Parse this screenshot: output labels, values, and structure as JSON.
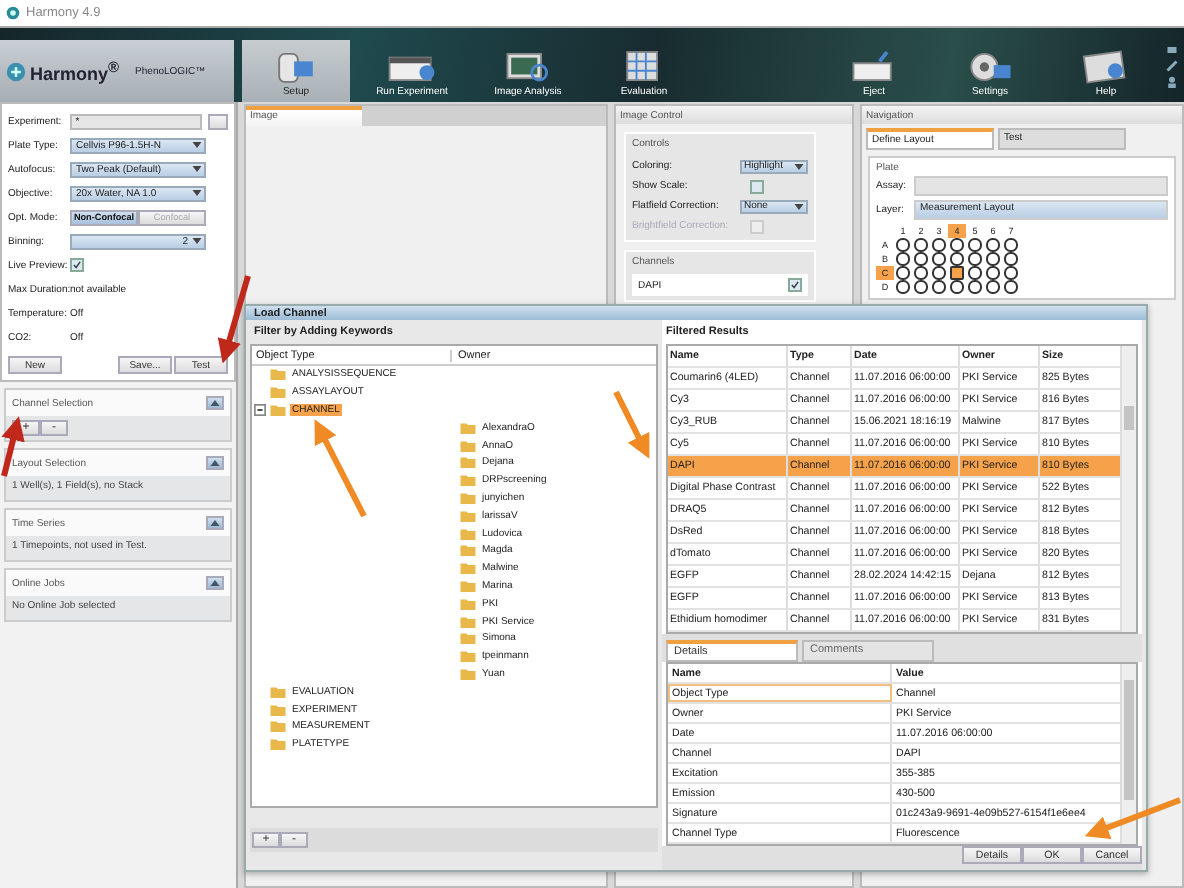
{
  "window": {
    "title": "Harmony 4.9"
  },
  "logo": {
    "name": "Harmony$^{®}$",
    "product": "PhenoLOGIC™"
  },
  "nav": [
    {
      "label": "Setup",
      "kind": "setup",
      "selected": true
    },
    {
      "label": "Run Experiment",
      "kind": "run",
      "selected": false
    },
    {
      "label": "Image Analysis",
      "kind": "analysis",
      "selected": false
    },
    {
      "label": "Evaluation",
      "kind": "evaluation",
      "selected": false
    },
    {
      "label": "Eject",
      "kind": "eject",
      "selected": false
    },
    {
      "label": "Settings",
      "kind": "settings",
      "selected": false
    },
    {
      "label": "Help",
      "kind": "help",
      "selected": false
    }
  ],
  "setup": {
    "fields": [
      {
        "label": "Experiment:",
        "kind": "input",
        "value": "*"
      },
      {
        "label": "Plate Type:",
        "kind": "dropdown",
        "value": "Cellvis P96-1.5H-N"
      },
      {
        "label": "Autofocus:",
        "kind": "dropdown",
        "value": "Two Peak (Default)"
      },
      {
        "label": "Objective:",
        "kind": "dropdown",
        "value": "20x Water, NA 1.0"
      },
      {
        "label": "Opt. Mode:",
        "kind": "segmented",
        "options": [
          {
            "label": "Non-Confocal",
            "selected": true
          },
          {
            "label": "Confocal",
            "selected": false
          }
        ]
      },
      {
        "label": "Binning:",
        "kind": "dropdown",
        "value": "2"
      },
      {
        "label": "Live Preview:",
        "kind": "checkbox",
        "checked": true
      },
      {
        "label": "Max Duration:",
        "kind": "text",
        "value": "not available"
      },
      {
        "label": "Temperature:",
        "kind": "text",
        "value": "Off"
      },
      {
        "label": "CO2:",
        "kind": "text",
        "value": "Off"
      }
    ],
    "buttons": [
      "New",
      "Save...",
      "Test"
    ]
  },
  "panels": [
    {
      "title": "Channel Selection",
      "buttons": [
        "+",
        "-"
      ]
    },
    {
      "title": "Layout Selection",
      "summary": "1 Well(s), 1 Field(s), no Stack"
    },
    {
      "title": "Time Series",
      "summary": "1 Timepoints, not used in Test."
    },
    {
      "title": "Online Jobs",
      "summary": "No Online Job selected"
    }
  ],
  "image_panel": {
    "tab": "Image"
  },
  "image_control": {
    "title": "Image Control",
    "controls_title": "Controls",
    "rows": [
      {
        "label": "Coloring:",
        "kind": "dropdown",
        "value": "Highlight",
        "disabled": false
      },
      {
        "label": "Show Scale:",
        "kind": "checkbox",
        "checked": false,
        "disabled": false
      },
      {
        "label": "Flatfield Correction:",
        "kind": "dropdown",
        "value": "None",
        "disabled": false
      },
      {
        "label": "Brightfield Correction:",
        "kind": "checkbox",
        "checked": false,
        "disabled": true
      }
    ],
    "channels_title": "Channels",
    "channels": [
      {
        "name": "DAPI",
        "checked": true
      }
    ]
  },
  "navigation": {
    "title": "Navigation",
    "tabs": [
      {
        "label": "Define Layout",
        "selected": true
      },
      {
        "label": "Test",
        "selected": false
      }
    ],
    "plate_title": "Plate",
    "assay_label": "Assay:",
    "layer_label": "Layer:",
    "layer_value": "Measurement Layout",
    "columns": [
      {
        "label": "1",
        "selected": false
      },
      {
        "label": "2",
        "selected": false
      },
      {
        "label": "3",
        "selected": false
      },
      {
        "label": "4",
        "selected": true
      },
      {
        "label": "5",
        "selected": false
      },
      {
        "label": "6",
        "selected": false
      },
      {
        "label": "7",
        "selected": false
      }
    ],
    "rows": [
      {
        "label": "A",
        "selected": false
      },
      {
        "label": "B",
        "selected": false
      },
      {
        "label": "C",
        "selected": true
      },
      {
        "label": "D",
        "selected": false
      }
    ]
  },
  "dialog": {
    "title": "Load Channel",
    "filter_title": "Filter by Adding Keywords",
    "tree_columns": [
      "Object Type",
      "Owner"
    ],
    "tree": [
      {
        "label": "ANALYSISSEQUENCE",
        "selected": false
      },
      {
        "label": "ASSAYLAYOUT",
        "selected": false
      },
      {
        "label": "CHANNEL",
        "selected": true,
        "children": [
          {
            "label": "AlexandraO"
          },
          {
            "label": "AnnaO"
          },
          {
            "label": "Dejana"
          },
          {
            "label": "DRPscreening"
          },
          {
            "label": "junyichen"
          },
          {
            "label": "larissaV"
          },
          {
            "label": "Ludovica"
          },
          {
            "label": "Magda"
          },
          {
            "label": "Malwine"
          },
          {
            "label": "Marina"
          },
          {
            "label": "PKI"
          },
          {
            "label": "PKI Service"
          },
          {
            "label": "Simona"
          },
          {
            "label": "tpeinmann"
          },
          {
            "label": "Yuan"
          }
        ]
      },
      {
        "label": "EVALUATION",
        "selected": false
      },
      {
        "label": "EXPERIMENT",
        "selected": false
      },
      {
        "label": "MEASUREMENT",
        "selected": false
      },
      {
        "label": "PLATETYPE",
        "selected": false
      }
    ],
    "tree_buttons": [
      "+",
      "-"
    ],
    "results_title": "Filtered Results",
    "result_columns": [
      "Name",
      "Type",
      "Date",
      "Owner",
      "Size"
    ],
    "results": [
      {
        "cells": [
          "Coumarin6 (4LED)",
          "Channel",
          "11.07.2016 06:00:00",
          "PKI Service",
          "825 Bytes"
        ],
        "selected": false
      },
      {
        "cells": [
          "Cy3",
          "Channel",
          "11.07.2016 06:00:00",
          "PKI Service",
          "816 Bytes"
        ],
        "selected": false
      },
      {
        "cells": [
          "Cy3_RUB",
          "Channel",
          "15.06.2021 18:16:19",
          "Malwine",
          "817 Bytes"
        ],
        "selected": false
      },
      {
        "cells": [
          "Cy5",
          "Channel",
          "11.07.2016 06:00:00",
          "PKI Service",
          "810 Bytes"
        ],
        "selected": false
      },
      {
        "cells": [
          "DAPI",
          "Channel",
          "11.07.2016 06:00:00",
          "PKI Service",
          "810 Bytes"
        ],
        "selected": true
      },
      {
        "cells": [
          "Digital Phase Contrast",
          "Channel",
          "11.07.2016 06:00:00",
          "PKI Service",
          "522 Bytes"
        ],
        "selected": false
      },
      {
        "cells": [
          "DRAQ5",
          "Channel",
          "11.07.2016 06:00:00",
          "PKI Service",
          "812 Bytes"
        ],
        "selected": false
      },
      {
        "cells": [
          "DsRed",
          "Channel",
          "11.07.2016 06:00:00",
          "PKI Service",
          "818 Bytes"
        ],
        "selected": false
      },
      {
        "cells": [
          "dTomato",
          "Channel",
          "11.07.2016 06:00:00",
          "PKI Service",
          "820 Bytes"
        ],
        "selected": false
      },
      {
        "cells": [
          "EGFP",
          "Channel",
          "28.02.2024 14:42:15",
          "Dejana",
          "812 Bytes"
        ],
        "selected": false
      },
      {
        "cells": [
          "EGFP",
          "Channel",
          "11.07.2016 06:00:00",
          "PKI Service",
          "813 Bytes"
        ],
        "selected": false
      },
      {
        "cells": [
          "Ethidium homodimer",
          "Channel",
          "11.07.2016 06:00:00",
          "PKI Service",
          "831 Bytes"
        ],
        "selected": false
      }
    ],
    "detail_tabs": [
      {
        "label": "Details",
        "selected": true
      },
      {
        "label": "Comments",
        "selected": false
      }
    ],
    "detail_columns": [
      "Name",
      "Value"
    ],
    "details": [
      {
        "name": "Object Type",
        "value": "Channel"
      },
      {
        "name": "Owner",
        "value": "PKI Service"
      },
      {
        "name": "Date",
        "value": "11.07.2016 06:00:00"
      },
      {
        "name": "Channel",
        "value": "DAPI"
      },
      {
        "name": "Excitation",
        "value": "355-385"
      },
      {
        "name": "Emission",
        "value": "430-500"
      },
      {
        "name": "Signature",
        "value": "01c243a9-9691-4e09b527-6154f1e6ee4"
      },
      {
        "name": "Channel Type",
        "value": "Fluorescence"
      }
    ],
    "buttons": [
      "Details",
      "OK",
      "Cancel"
    ]
  }
}
